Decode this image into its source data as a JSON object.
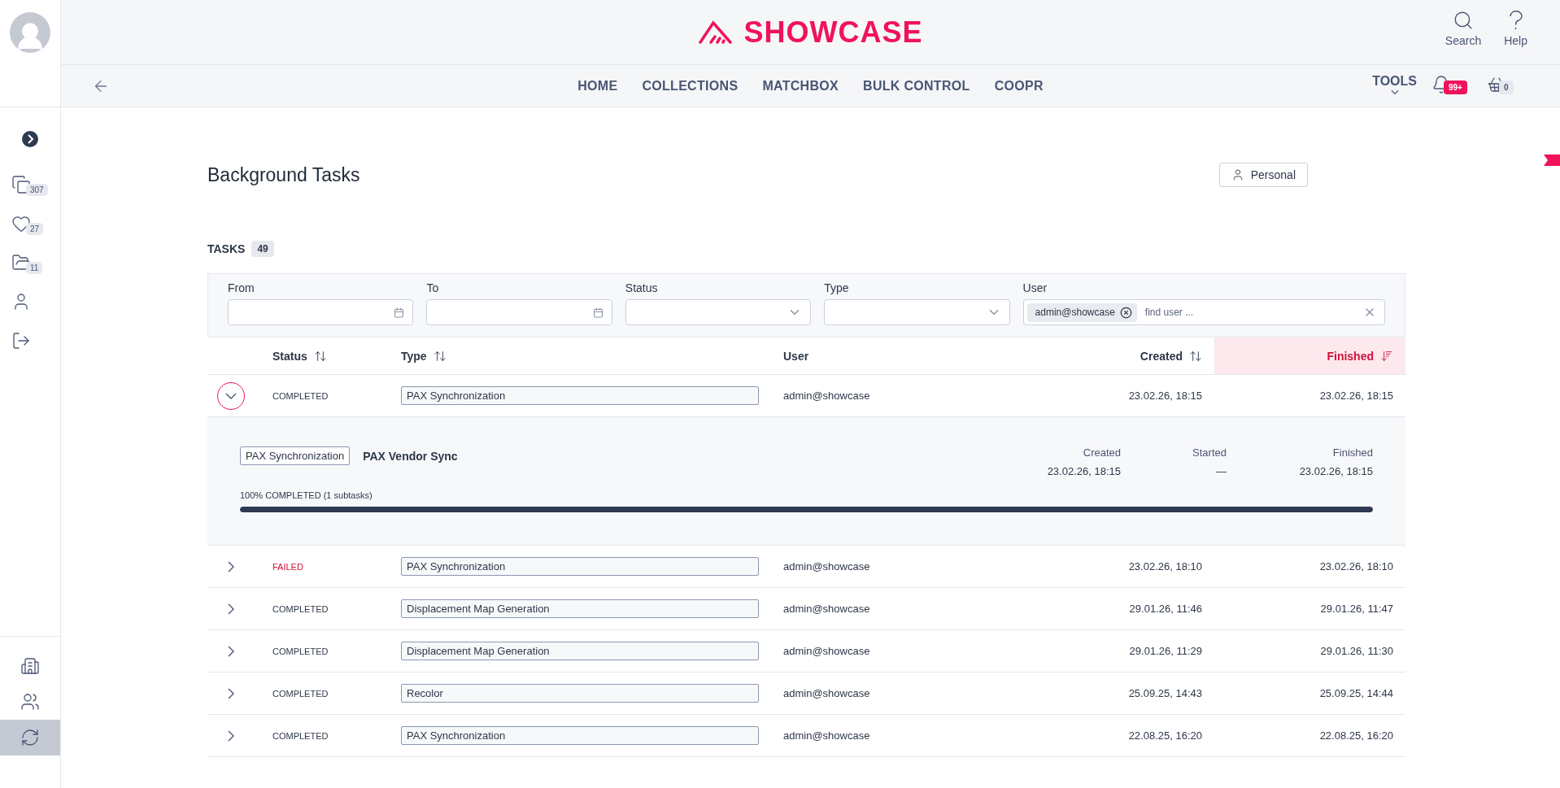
{
  "header": {
    "logo": "SHOWCASE",
    "actions": [
      {
        "label": "Search"
      },
      {
        "label": "Help"
      }
    ],
    "nav": [
      {
        "label": "HOME"
      },
      {
        "label": "COLLECTIONS"
      },
      {
        "label": "MATCHBOX"
      },
      {
        "label": "BULK CONTROL"
      },
      {
        "label": "COOPR"
      }
    ],
    "tools": "TOOLS",
    "notifications": "99+",
    "cart": "0"
  },
  "sidebar": {
    "items": [
      {
        "count": "307"
      },
      {
        "count": "27"
      },
      {
        "count": "11"
      }
    ],
    "bottom_items": [
      {
        "selected": false
      },
      {
        "selected": false
      },
      {
        "selected": true
      }
    ]
  },
  "page": {
    "title": "Background Tasks",
    "personal_button": "Personal",
    "tasks_label": "TASKS",
    "tasks_count": "49"
  },
  "filters": [
    {
      "kind": "date",
      "label": "From"
    },
    {
      "kind": "date",
      "label": "To"
    },
    {
      "kind": "select",
      "label": "Status"
    },
    {
      "kind": "select",
      "label": "Type"
    },
    {
      "kind": "user",
      "label": "User",
      "chip": "admin@showcase",
      "placeholder": "find user ..."
    }
  ],
  "table": {
    "columns": [
      {
        "label": "Status",
        "sortable": true,
        "selected": false
      },
      {
        "label": "Type",
        "sortable": true,
        "selected": false
      },
      {
        "label": "User",
        "sortable": false,
        "selected": false
      },
      {
        "label": "Created",
        "sortable": true,
        "selected": false
      },
      {
        "label": "Finished",
        "sortable": true,
        "selected": true
      }
    ],
    "rows": [
      {
        "expanded": true,
        "status": "COMPLETED",
        "color": "#2d3748",
        "type": "PAX Synchronization",
        "user": "admin@showcase",
        "created": "23.02.26, 18:15",
        "finished": "23.02.26, 18:15",
        "detail": {
          "tag": "PAX Synchronization",
          "name": "PAX Vendor Sync",
          "times": [
            {
              "label": "Created",
              "value": "23.02.26, 18:15"
            },
            {
              "label": "Started",
              "value": "—"
            },
            {
              "label": "Finished",
              "value": "23.02.26, 18:15"
            }
          ],
          "progress_text": "100% COMPLETED (1 subtasks)",
          "level": 1
        }
      },
      {
        "expanded": false,
        "status": "FAILED",
        "color": "#d0103a",
        "type": "PAX Synchronization",
        "user": "admin@showcase",
        "created": "23.02.26, 18:10",
        "finished": "23.02.26, 18:10"
      },
      {
        "expanded": false,
        "status": "COMPLETED",
        "color": "#2d3748",
        "type": "Displacement Map Generation",
        "user": "admin@showcase",
        "created": "29.01.26, 11:46",
        "finished": "29.01.26, 11:47"
      },
      {
        "expanded": false,
        "status": "COMPLETED",
        "color": "#2d3748",
        "type": "Displacement Map Generation",
        "user": "admin@showcase",
        "created": "29.01.26, 11:29",
        "finished": "29.01.26, 11:30"
      },
      {
        "expanded": false,
        "status": "COMPLETED",
        "color": "#2d3748",
        "type": "Recolor",
        "user": "admin@showcase",
        "created": "25.09.25, 14:43",
        "finished": "25.09.25, 14:44"
      },
      {
        "expanded": false,
        "status": "COMPLETED",
        "color": "#2d3748",
        "type": "PAX Synchronization",
        "user": "admin@showcase",
        "created": "22.08.25, 16:20",
        "finished": "22.08.25, 16:20"
      }
    ]
  }
}
